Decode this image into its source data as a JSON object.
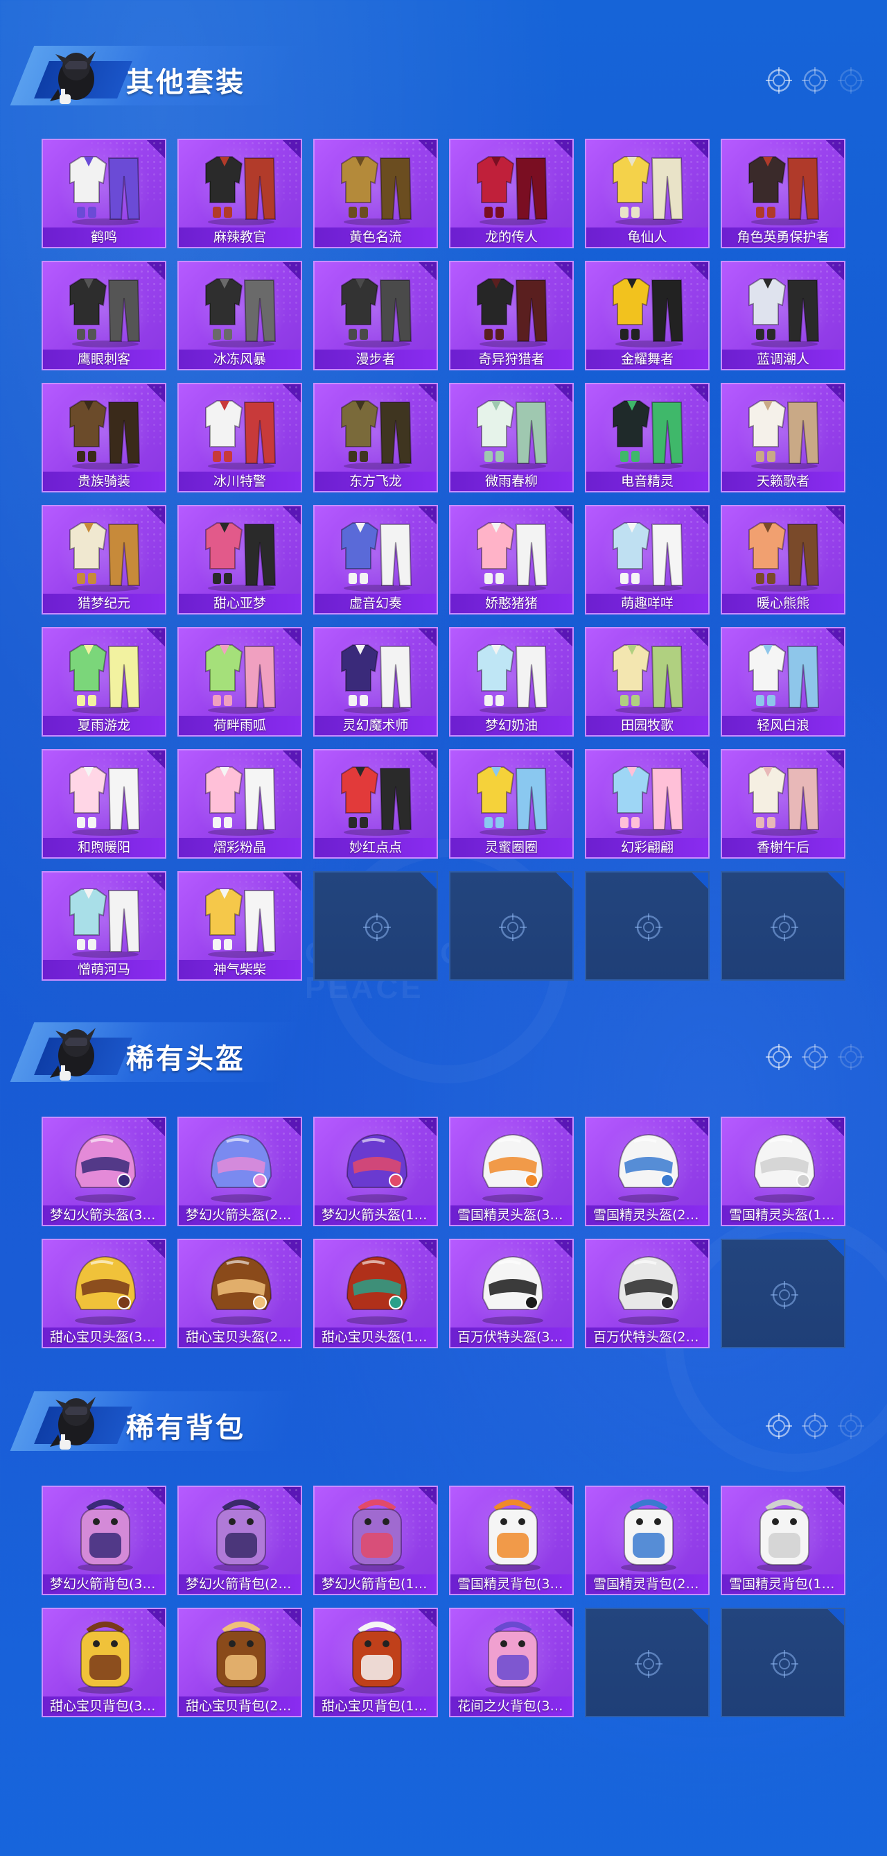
{
  "sections": [
    {
      "title": "其他套装",
      "items": [
        {
          "label": "鹤鸣",
          "icon": "hoodie-outfit-icon",
          "palette": [
            "#f2f2f2",
            "#6b4bd6"
          ]
        },
        {
          "label": "麻辣教官",
          "icon": "outfit-icon",
          "palette": [
            "#2a2a2a",
            "#b23b2a"
          ]
        },
        {
          "label": "黄色名流",
          "icon": "suit-outfit-icon",
          "palette": [
            "#b48a3a",
            "#6b4d20"
          ]
        },
        {
          "label": "龙的传人",
          "icon": "dress-outfit-icon",
          "palette": [
            "#c0203a",
            "#7a0e22"
          ]
        },
        {
          "label": "龟仙人",
          "icon": "shirt-outfit-icon",
          "palette": [
            "#f4d24a",
            "#e9e3c8"
          ]
        },
        {
          "label": "角色英勇保护者",
          "icon": "armor-outfit-icon",
          "palette": [
            "#3a2a2a",
            "#b03a2a"
          ]
        },
        {
          "label": "鹰眼刺客",
          "icon": "outfit-icon",
          "palette": [
            "#2d2d2d",
            "#555555"
          ]
        },
        {
          "label": "冰冻风暴",
          "icon": "outfit-icon",
          "palette": [
            "#2f2f2f",
            "#6a6a6a"
          ]
        },
        {
          "label": "漫步者",
          "icon": "outfit-icon",
          "palette": [
            "#333333",
            "#4a4a4a"
          ]
        },
        {
          "label": "奇异狩猎者",
          "icon": "outfit-icon",
          "palette": [
            "#262626",
            "#5a1f1f"
          ]
        },
        {
          "label": "金耀舞者",
          "icon": "outfit-icon",
          "palette": [
            "#f2c21e",
            "#222222"
          ]
        },
        {
          "label": "蓝调潮人",
          "icon": "outfit-icon",
          "palette": [
            "#dfe3ee",
            "#2a2a2a"
          ]
        },
        {
          "label": "贵族骑装",
          "icon": "outfit-icon",
          "palette": [
            "#6b4b2a",
            "#3a2a1a"
          ]
        },
        {
          "label": "冰川特警",
          "icon": "outfit-icon",
          "palette": [
            "#f3f3f3",
            "#c83a3a"
          ]
        },
        {
          "label": "东方飞龙",
          "icon": "outfit-icon",
          "palette": [
            "#7a6a3a",
            "#3f3520"
          ]
        },
        {
          "label": "微雨春柳",
          "icon": "outfit-icon",
          "palette": [
            "#e6f3ea",
            "#9fc8b0"
          ]
        },
        {
          "label": "电音精灵",
          "icon": "outfit-icon",
          "palette": [
            "#1f2a2a",
            "#3fb86a"
          ]
        },
        {
          "label": "天籁歌者",
          "icon": "outfit-icon",
          "palette": [
            "#f5f1ea",
            "#c9a986"
          ]
        },
        {
          "label": "猎梦纪元",
          "icon": "outfit-icon",
          "palette": [
            "#f0e8d0",
            "#c78a3a"
          ]
        },
        {
          "label": "甜心亚梦",
          "icon": "outfit-icon",
          "palette": [
            "#e25a8a",
            "#2a2a2a"
          ]
        },
        {
          "label": "虚音幻奏",
          "icon": "outfit-icon",
          "palette": [
            "#5a6ad8",
            "#f3f3f3"
          ]
        },
        {
          "label": "娇憨猪猪",
          "icon": "outfit-icon",
          "palette": [
            "#ffb3c8",
            "#f3f3f3"
          ]
        },
        {
          "label": "萌趣咩咩",
          "icon": "outfit-icon",
          "palette": [
            "#bfe0f2",
            "#f5f5f5"
          ]
        },
        {
          "label": "暖心熊熊",
          "icon": "outfit-icon",
          "palette": [
            "#f1a070",
            "#7a4a2a"
          ]
        },
        {
          "label": "夏雨游龙",
          "icon": "outfit-icon",
          "palette": [
            "#7bd67a",
            "#f2f2a0"
          ]
        },
        {
          "label": "荷畔雨呱",
          "icon": "outfit-icon",
          "palette": [
            "#a5e07a",
            "#f0a0c0"
          ]
        },
        {
          "label": "灵幻魔术师",
          "icon": "outfit-icon",
          "palette": [
            "#3a2a7a",
            "#f3f3f3"
          ]
        },
        {
          "label": "梦幻奶油",
          "icon": "outfit-icon",
          "palette": [
            "#bfe6f5",
            "#f3f3f3"
          ]
        },
        {
          "label": "田园牧歌",
          "icon": "outfit-icon",
          "palette": [
            "#f3e6b0",
            "#b0d080"
          ]
        },
        {
          "label": "轻风白浪",
          "icon": "outfit-icon",
          "palette": [
            "#f5f5f5",
            "#8ec6ea"
          ]
        },
        {
          "label": "和煦暖阳",
          "icon": "outfit-icon",
          "palette": [
            "#ffd6e6",
            "#f5f5f5"
          ]
        },
        {
          "label": "熠彩粉晶",
          "icon": "outfit-icon",
          "palette": [
            "#ffc0d8",
            "#f5f5f5"
          ]
        },
        {
          "label": "妙红点点",
          "icon": "outfit-icon",
          "palette": [
            "#e23a3a",
            "#2a2a2a"
          ]
        },
        {
          "label": "灵蜜圈圈",
          "icon": "outfit-icon",
          "palette": [
            "#f5d23a",
            "#8ac8f0"
          ]
        },
        {
          "label": "幻彩翩翩",
          "icon": "outfit-icon",
          "palette": [
            "#9ed6f5",
            "#ffc0d8"
          ]
        },
        {
          "label": "香榭午后",
          "icon": "outfit-icon",
          "palette": [
            "#f5efe2",
            "#e8b8b8"
          ]
        },
        {
          "label": "憎萌河马",
          "icon": "outfit-icon",
          "palette": [
            "#a9dfe8",
            "#f3f3f3"
          ]
        },
        {
          "label": "神气柴柴",
          "icon": "outfit-icon",
          "palette": [
            "#f5c84a",
            "#f5f5f5"
          ]
        }
      ],
      "empty_slots": 4
    },
    {
      "title": "稀有头盔",
      "items": [
        {
          "label": "梦幻火箭头盔(3…",
          "icon": "helmet-icon",
          "palette": [
            "#e48ad8",
            "#3a2a7a"
          ]
        },
        {
          "label": "梦幻火箭头盔(2…",
          "icon": "helmet-icon",
          "palette": [
            "#7a8af0",
            "#e48ad8"
          ]
        },
        {
          "label": "梦幻火箭头盔(1…",
          "icon": "helmet-icon",
          "palette": [
            "#6a3ad0",
            "#e24a6a"
          ]
        },
        {
          "label": "雪国精灵头盔(3…",
          "icon": "helmet-icon",
          "palette": [
            "#f5f5f5",
            "#f08a2a"
          ]
        },
        {
          "label": "雪国精灵头盔(2…",
          "icon": "helmet-icon",
          "palette": [
            "#f5f5f5",
            "#3a7ad0"
          ]
        },
        {
          "label": "雪国精灵头盔(1…",
          "icon": "helmet-icon",
          "palette": [
            "#f5f5f5",
            "#d0d0d0"
          ]
        },
        {
          "label": "甜心宝贝头盔(3…",
          "icon": "helmet-icon",
          "palette": [
            "#f0c23a",
            "#7a3a1a"
          ]
        },
        {
          "label": "甜心宝贝头盔(2…",
          "icon": "helmet-icon",
          "palette": [
            "#8a4a1a",
            "#f0c07a"
          ]
        },
        {
          "label": "甜心宝贝头盔(1…",
          "icon": "helmet-icon",
          "palette": [
            "#b0301a",
            "#2aa08a"
          ]
        },
        {
          "label": "百万伏特头盔(3…",
          "icon": "helmet-icon",
          "palette": [
            "#f5f5f5",
            "#1a1a1a"
          ]
        },
        {
          "label": "百万伏特头盔(2…",
          "icon": "helmet-icon",
          "palette": [
            "#e8e8e8",
            "#2a2a2a"
          ]
        }
      ],
      "empty_slots": 1
    },
    {
      "title": "稀有背包",
      "items": [
        {
          "label": "梦幻火箭背包(3…",
          "icon": "backpack-icon",
          "palette": [
            "#d48ad8",
            "#3a2a7a"
          ]
        },
        {
          "label": "梦幻火箭背包(2…",
          "icon": "backpack-icon",
          "palette": [
            "#b07ad8",
            "#3a2a6a"
          ]
        },
        {
          "label": "梦幻火箭背包(1…",
          "icon": "backpack-icon",
          "palette": [
            "#a06ad0",
            "#e24a6a"
          ]
        },
        {
          "label": "雪国精灵背包(3…",
          "icon": "backpack-icon",
          "palette": [
            "#f5f5f5",
            "#f08a2a"
          ]
        },
        {
          "label": "雪国精灵背包(2…",
          "icon": "backpack-icon",
          "palette": [
            "#f5f5f5",
            "#3a7ad0"
          ]
        },
        {
          "label": "雪国精灵背包(1…",
          "icon": "backpack-icon",
          "palette": [
            "#f5f5f5",
            "#d0d0d0"
          ]
        },
        {
          "label": "甜心宝贝背包(3…",
          "icon": "backpack-icon",
          "palette": [
            "#f0c23a",
            "#7a3a1a"
          ]
        },
        {
          "label": "甜心宝贝背包(2…",
          "icon": "backpack-icon",
          "palette": [
            "#8a4a1a",
            "#f0c07a"
          ]
        },
        {
          "label": "甜心宝贝背包(1…",
          "icon": "backpack-icon",
          "palette": [
            "#c0401a",
            "#f5f5f5"
          ]
        },
        {
          "label": "花间之火背包(3…",
          "icon": "backpack-icon",
          "palette": [
            "#f0a0d0",
            "#6a4ad0"
          ]
        }
      ],
      "empty_slots": 2
    }
  ],
  "watermark_text": "GAME FOR PEACE",
  "colors": {
    "background": "#1559d2",
    "card": "#a14df2",
    "label_bar": "#7a26e0",
    "empty_slot": "#213f78"
  }
}
